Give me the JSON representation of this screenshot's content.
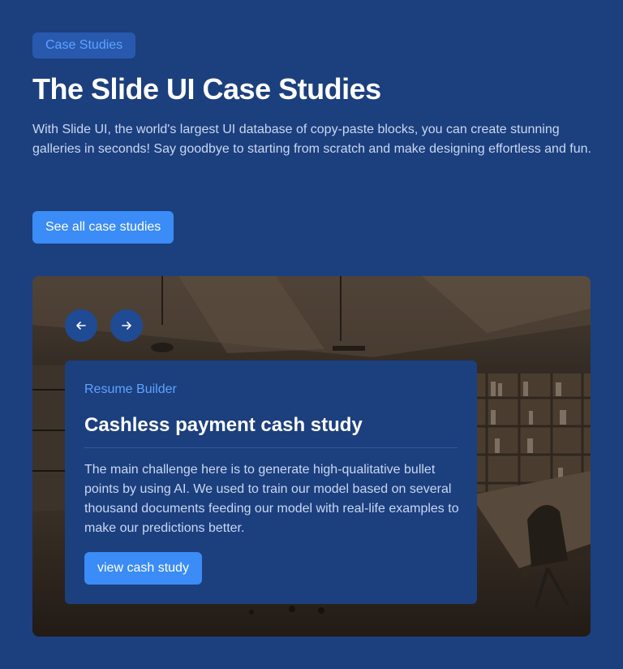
{
  "header": {
    "badge": "Case Studies",
    "title": "The Slide UI Case Studies",
    "description": "With Slide UI, the world's largest UI database of copy-paste blocks, you can create stunning galleries in seconds! Say goodbye to starting from scratch and make designing effortless and fun.",
    "cta_label": "See all case studies"
  },
  "slider": {
    "prev_icon": "arrow-left-icon",
    "next_icon": "arrow-right-icon",
    "background": "office-interior-photo",
    "card": {
      "category": "Resume Builder",
      "title": "Cashless payment cash study",
      "body": "The main challenge here is to generate high-qualitative bullet points by using AI. We used to train our model based on several thousand documents feeding our model with real-life examples to make our predictions better.",
      "button_label": "view cash study"
    }
  },
  "colors": {
    "page_background": "#1c3f7e",
    "accent": "#3b8cf6",
    "badge_background": "#2859ae",
    "badge_text": "#5fa2ff"
  }
}
